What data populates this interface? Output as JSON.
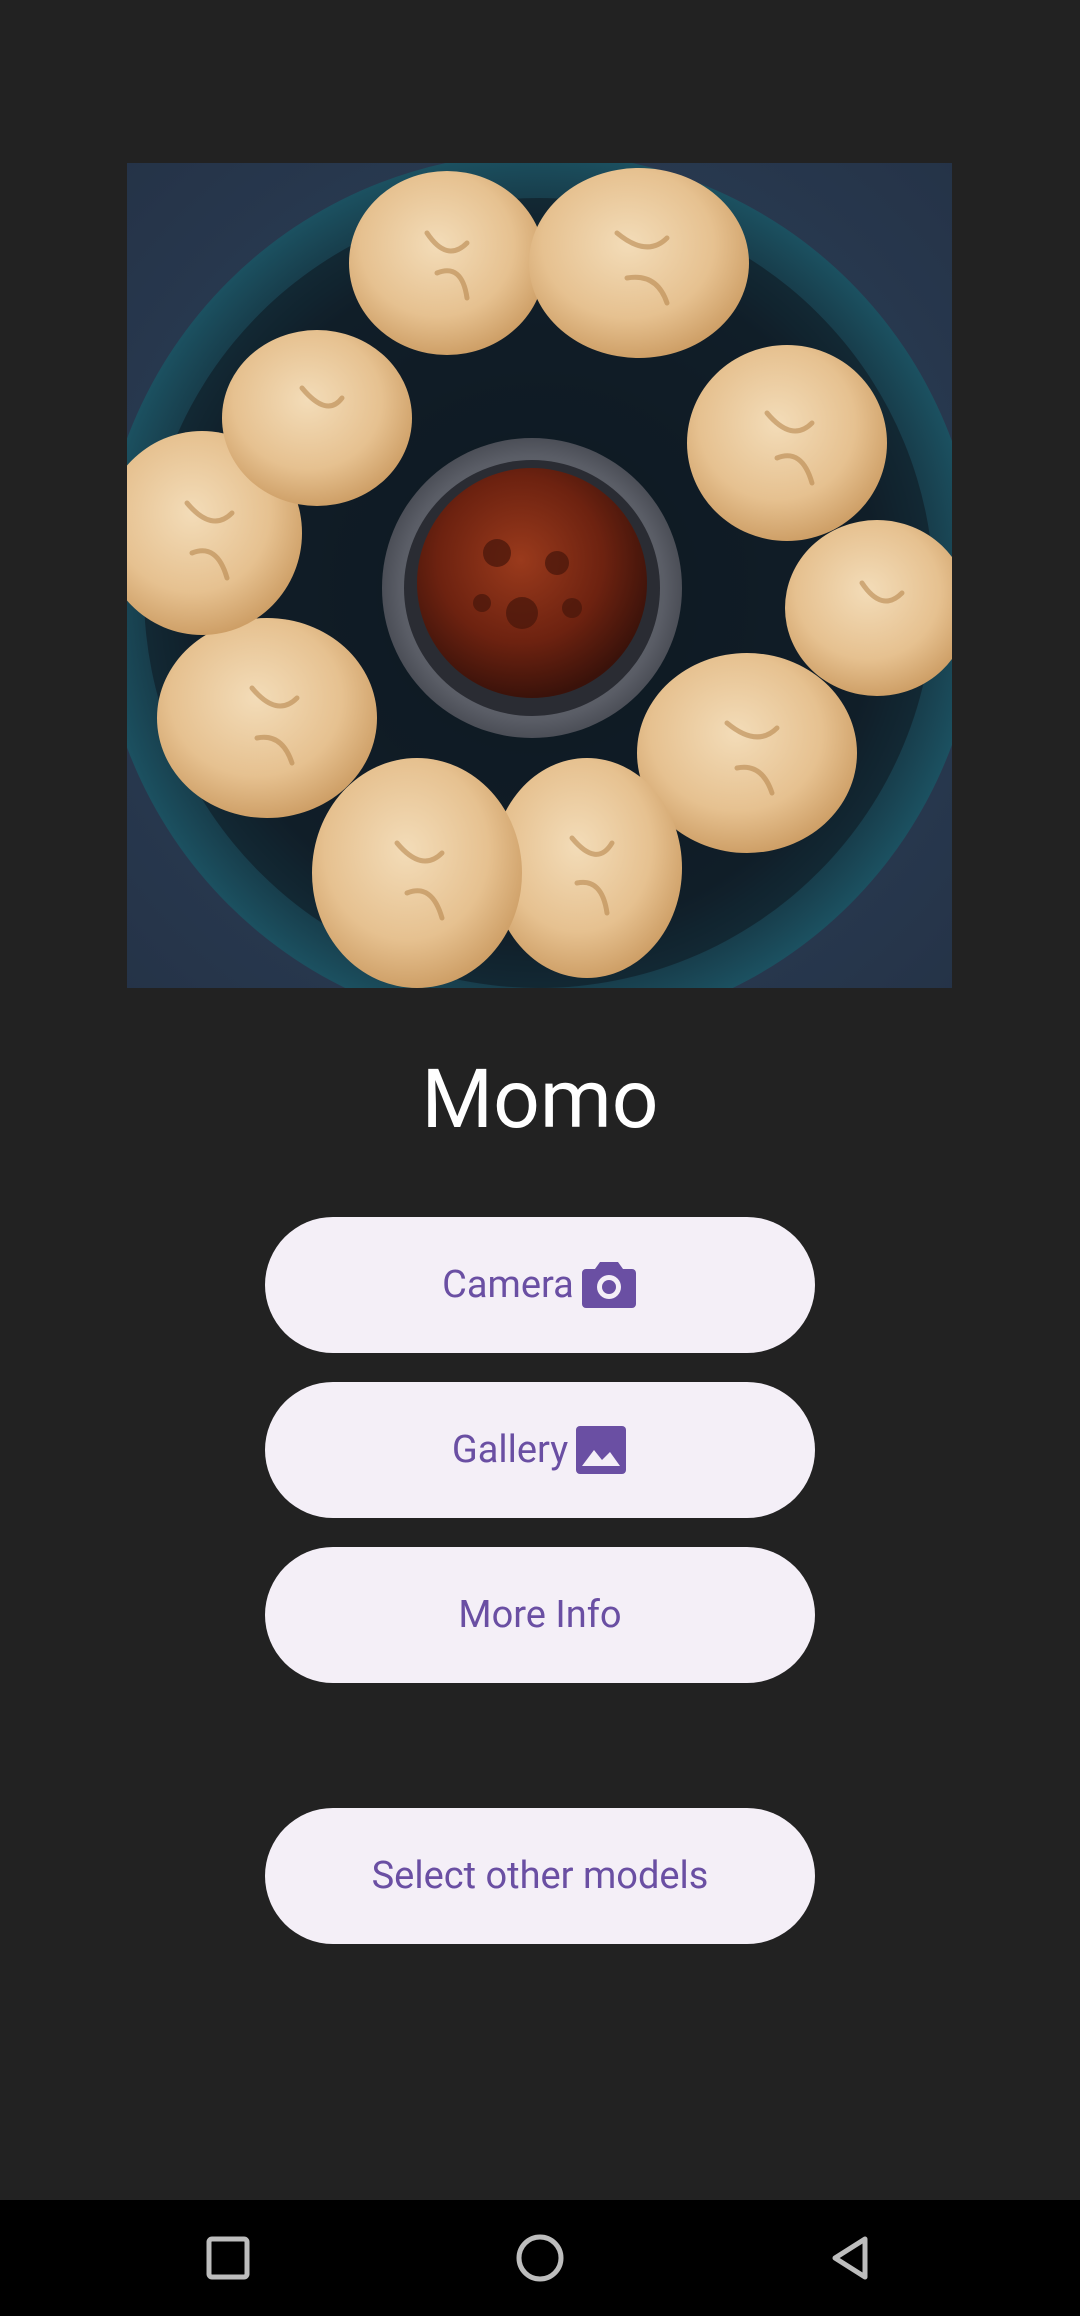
{
  "prediction": {
    "label": "Momo"
  },
  "image": {
    "subject": "momo-dumplings-plate"
  },
  "buttons": {
    "camera": {
      "label": "Camera",
      "icon": "camera-icon"
    },
    "gallery": {
      "label": "Gallery",
      "icon": "image-icon"
    },
    "more_info": {
      "label": "More Info"
    },
    "select_models": {
      "label": "Select other models"
    }
  },
  "nav": {
    "recent": "recent-apps-icon",
    "home": "home-icon",
    "back": "back-icon"
  },
  "colors": {
    "background": "#222222",
    "button_bg": "#f4eff7",
    "button_text": "#6a4fa3",
    "nav_bar": "#000000"
  }
}
